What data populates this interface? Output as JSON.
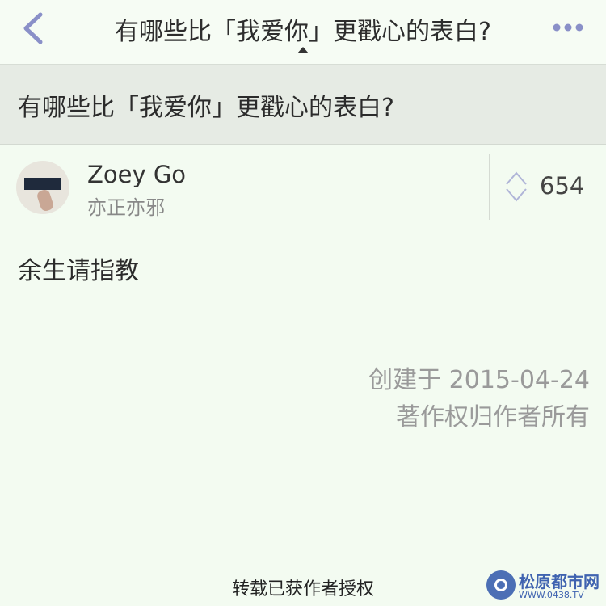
{
  "navbar": {
    "title": "有哪些比「我爱你」更戳心的表白?",
    "back_icon": "chevron-left-icon",
    "more_icon": "more-dots-icon",
    "accent_color": "#8a90c8"
  },
  "question": {
    "title": "有哪些比「我爱你」更戳心的表白?"
  },
  "author": {
    "name": "Zoey Go",
    "bio": "亦正亦邪",
    "avatar_icon": "avatar-photo"
  },
  "vote": {
    "icon": "vote-arrows-icon",
    "count": "654"
  },
  "answer": {
    "content": "余生请指教"
  },
  "meta": {
    "created": "创建于 2015-04-24",
    "copyright": "著作权归作者所有"
  },
  "footer": {
    "repost_note": "转载已获作者授权"
  },
  "watermark": {
    "name": "松原都市网",
    "url": "WWW.0438.TV",
    "color": "#3f63b0"
  }
}
